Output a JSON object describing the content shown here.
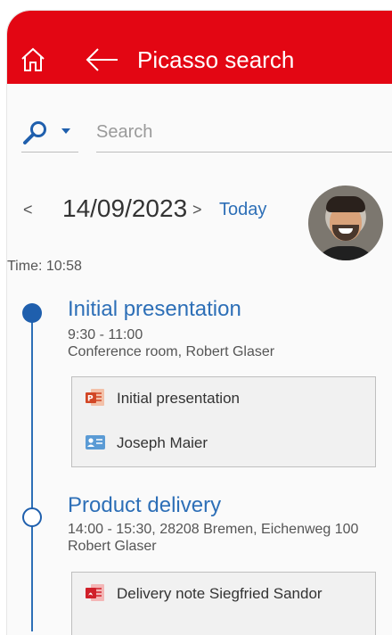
{
  "header": {
    "title": "Picasso search"
  },
  "search": {
    "placeholder": "Search",
    "value": ""
  },
  "date_nav": {
    "prev": "<",
    "date": "14/09/2023",
    "next": ">",
    "today": "Today"
  },
  "time": "Time: 10:58",
  "events": [
    {
      "title": "Initial presentation",
      "line1": "9:30 - 11:00",
      "line2": "Conference room, Robert Glaser",
      "items": [
        {
          "label": "Initial presentation",
          "icon": "powerpoint-icon"
        },
        {
          "label": "Joseph Maier",
          "icon": "contact-card-icon"
        }
      ]
    },
    {
      "title": "Product delivery",
      "line1": "14:00 - 15:30, 28208 Bremen, Eichenweg 100",
      "line2": "Robert Glaser",
      "items": [
        {
          "label": "Delivery note Siegfried Sandor",
          "icon": "pdf-icon"
        }
      ]
    }
  ],
  "colors": {
    "brand": "#e30613",
    "accent": "#2d6fb7",
    "timeline": "#1f5fad"
  }
}
